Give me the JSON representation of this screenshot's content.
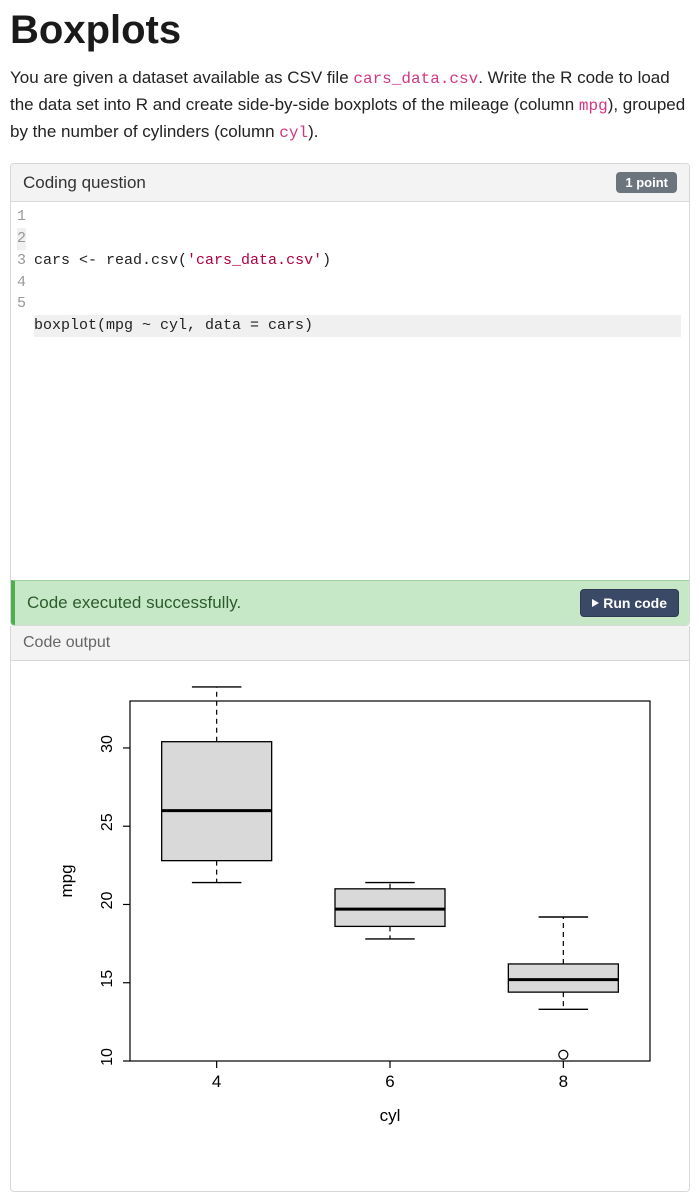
{
  "title": "Boxplots",
  "intro": {
    "t1": "You are given a dataset available as CSV file ",
    "file": "cars_data.csv",
    "t2": ". Write the R code to load the data set into R and create side-by-side boxplots of the mileage (column ",
    "col1": "mpg",
    "t3": "), grouped by the number of cylinders (column ",
    "col2": "cyl",
    "t4": ")."
  },
  "panel": {
    "header_label": "Coding question",
    "points_label": "1 point"
  },
  "code": {
    "lines": [
      "1",
      "2",
      "3",
      "4",
      "5"
    ],
    "l1a": "cars <- read.csv(",
    "l1b": "'cars_data.csv'",
    "l1c": ")",
    "l2": "boxplot(mpg ~ cyl, data = cars)"
  },
  "status": {
    "text": "Code executed successfully.",
    "run_label": "Run code"
  },
  "output": {
    "header": "Code output"
  },
  "chart_data": {
    "type": "boxplot",
    "xlabel": "cyl",
    "ylabel": "mpg",
    "ylim": [
      10,
      33
    ],
    "yticks": [
      10,
      15,
      20,
      25,
      30
    ],
    "categories": [
      "4",
      "6",
      "8"
    ],
    "series": [
      {
        "name": "4",
        "min": 21.4,
        "q1": 22.8,
        "median": 26.0,
        "q3": 30.4,
        "max": 33.9,
        "outliers": []
      },
      {
        "name": "6",
        "min": 17.8,
        "q1": 18.6,
        "median": 19.7,
        "q3": 21.0,
        "max": 21.4,
        "outliers": []
      },
      {
        "name": "8",
        "min": 13.3,
        "q1": 14.4,
        "median": 15.2,
        "q3": 16.2,
        "max": 19.2,
        "outliers": [
          10.4
        ]
      }
    ]
  }
}
